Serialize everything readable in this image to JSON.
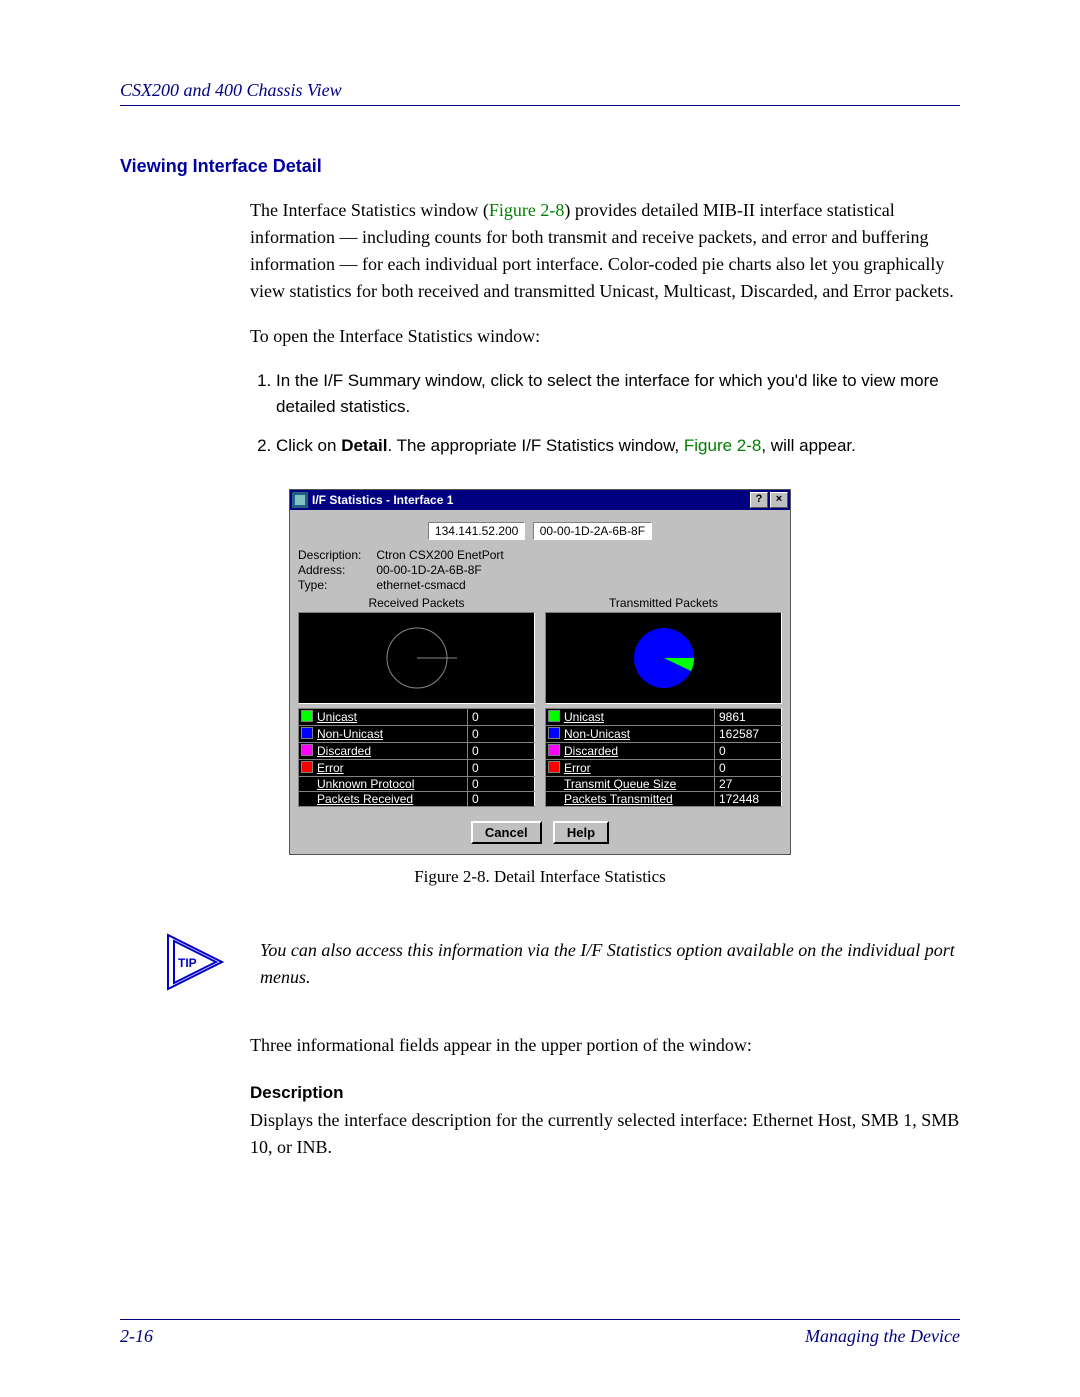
{
  "header": "CSX200 and 400 Chassis View",
  "section_title": "Viewing Interface Detail",
  "para1_a": "The Interface Statistics window (",
  "para1_fig": "Figure 2-8",
  "para1_b": ") provides detailed MIB-II interface statistical information — including counts for both transmit and receive packets, and error and buffering information — for each individual port interface. Color-coded pie charts also let you graphically view statistics for both received and transmitted Unicast, Multicast, Discarded, and Error packets.",
  "para2": "To open the Interface Statistics window:",
  "step1": "In the I/F Summary window, click to select the interface for which you'd like to view more detailed statistics.",
  "step2_a": "Click on ",
  "step2_bold": "Detail",
  "step2_b": ". The appropriate I/F Statistics window, ",
  "step2_fig": "Figure 2-8",
  "step2_c": ", will appear.",
  "dialog": {
    "title": "I/F Statistics - Interface 1",
    "ip": "134.141.52.200",
    "mac_top": "00-00-1D-2A-6B-8F",
    "desc_label": "Description:",
    "desc_val": "Ctron CSX200 EnetPort",
    "addr_label": "Address:",
    "addr_val": "00-00-1D-2A-6B-8F",
    "type_label": "Type:",
    "type_val": "ethernet-csmacd",
    "received_title": "Received Packets",
    "transmitted_title": "Transmitted Packets",
    "recv_rows": [
      {
        "color": "#00ff00",
        "name": "Unicast",
        "val": "0"
      },
      {
        "color": "#0000ff",
        "name": "Non-Unicast",
        "val": "0"
      },
      {
        "color": "#ff00ff",
        "name": "Discarded",
        "val": "0"
      },
      {
        "color": "#ff0000",
        "name": "Error",
        "val": "0"
      },
      {
        "color": "",
        "name": "Unknown Protocol",
        "val": "0"
      },
      {
        "color": "",
        "name": "Packets Received",
        "val": "0"
      }
    ],
    "trans_rows": [
      {
        "color": "#00ff00",
        "name": "Unicast",
        "val": "9861"
      },
      {
        "color": "#0000ff",
        "name": "Non-Unicast",
        "val": "162587"
      },
      {
        "color": "#ff00ff",
        "name": "Discarded",
        "val": "0"
      },
      {
        "color": "#ff0000",
        "name": "Error",
        "val": "0"
      },
      {
        "color": "",
        "name": "Transmit Queue Size",
        "val": "27"
      },
      {
        "color": "",
        "name": "Packets Transmitted",
        "val": "172448"
      }
    ],
    "cancel": "Cancel",
    "help": "Help"
  },
  "fig_caption": "Figure 2-8. Detail Interface Statistics",
  "tip_label": "TIP",
  "tip_text": "You can also access this information via the I/F Statistics option available on the individual port menus.",
  "para3": "Three informational fields appear in the upper portion of the window:",
  "desc_title": "Description",
  "desc_body": "Displays the interface description for the currently selected interface: Ethernet Host, SMB 1, SMB 10, or INB.",
  "footer_left": "2-16",
  "footer_right": "Managing the Device",
  "chart_data": {
    "type": "pie",
    "title": "Transmitted Packets",
    "series": [
      {
        "name": "Unicast",
        "value": 9861,
        "color": "#00ff00"
      },
      {
        "name": "Non-Unicast",
        "value": 162587,
        "color": "#0000ff"
      },
      {
        "name": "Discarded",
        "value": 0,
        "color": "#ff00ff"
      },
      {
        "name": "Error",
        "value": 0,
        "color": "#ff0000"
      }
    ]
  }
}
